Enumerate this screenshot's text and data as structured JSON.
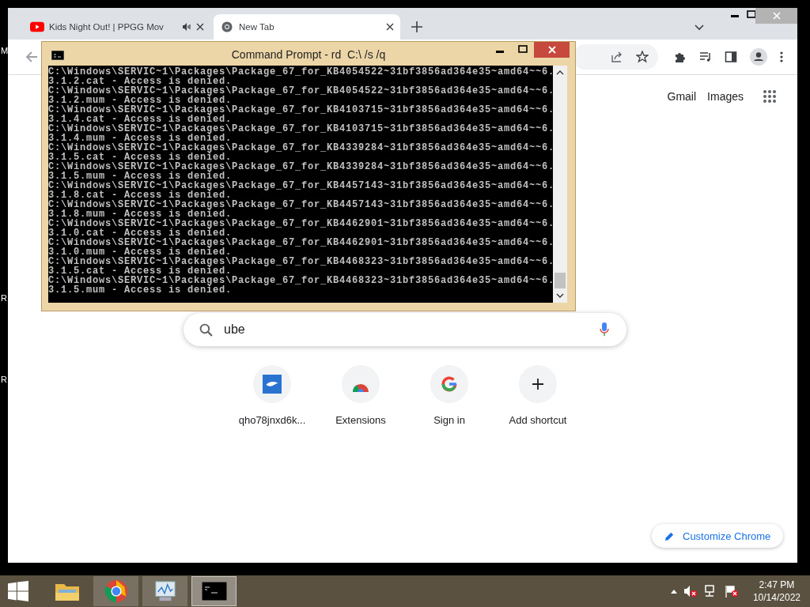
{
  "desktop_labels": [
    "M",
    "R",
    "R"
  ],
  "browser": {
    "tabs": [
      {
        "title": "Kids Night Out! | PPGG Mov",
        "kind": "video",
        "audio": true,
        "selected": false
      },
      {
        "title": "New Tab",
        "kind": "chrome",
        "audio": false,
        "selected": true
      }
    ],
    "top_links": [
      "Gmail",
      "Images"
    ],
    "search": {
      "value": "ube"
    },
    "shortcuts": [
      {
        "label": "qho78jnxd6k...",
        "kind": "site"
      },
      {
        "label": "Extensions",
        "kind": "webstore"
      },
      {
        "label": "Sign in",
        "kind": "google"
      },
      {
        "label": "Add shortcut",
        "kind": "add"
      }
    ],
    "customize_button": "Customize Chrome"
  },
  "cmd": {
    "title": "Command Prompt - rd  C:\\ /s /q",
    "lines": [
      "C:\\Windows\\SERVIC~1\\Packages\\Package_67_for_KB4054522~31bf3856ad364e35~amd64~~6.",
      "3.1.2.cat - Access is denied.",
      "C:\\Windows\\SERVIC~1\\Packages\\Package_67_for_KB4054522~31bf3856ad364e35~amd64~~6.",
      "3.1.2.mum - Access is denied.",
      "C:\\Windows\\SERVIC~1\\Packages\\Package_67_for_KB4103715~31bf3856ad364e35~amd64~~6.",
      "3.1.4.cat - Access is denied.",
      "C:\\Windows\\SERVIC~1\\Packages\\Package_67_for_KB4103715~31bf3856ad364e35~amd64~~6.",
      "3.1.4.mum - Access is denied.",
      "C:\\Windows\\SERVIC~1\\Packages\\Package_67_for_KB4339284~31bf3856ad364e35~amd64~~6.",
      "3.1.5.cat - Access is denied.",
      "C:\\Windows\\SERVIC~1\\Packages\\Package_67_for_KB4339284~31bf3856ad364e35~amd64~~6.",
      "3.1.5.mum - Access is denied.",
      "C:\\Windows\\SERVIC~1\\Packages\\Package_67_for_KB4457143~31bf3856ad364e35~amd64~~6.",
      "3.1.8.cat - Access is denied.",
      "C:\\Windows\\SERVIC~1\\Packages\\Package_67_for_KB4457143~31bf3856ad364e35~amd64~~6.",
      "3.1.8.mum - Access is denied.",
      "C:\\Windows\\SERVIC~1\\Packages\\Package_67_for_KB4462901~31bf3856ad364e35~amd64~~6.",
      "3.1.0.cat - Access is denied.",
      "C:\\Windows\\SERVIC~1\\Packages\\Package_67_for_KB4462901~31bf3856ad364e35~amd64~~6.",
      "3.1.0.mum - Access is denied.",
      "C:\\Windows\\SERVIC~1\\Packages\\Package_67_for_KB4468323~31bf3856ad364e35~amd64~~6.",
      "3.1.5.cat - Access is denied.",
      "C:\\Windows\\SERVIC~1\\Packages\\Package_67_for_KB4468323~31bf3856ad364e35~amd64~~6.",
      "3.1.5.mum - Access is denied."
    ]
  },
  "taskbar": {
    "apps": [
      {
        "kind": "folder",
        "selected": false
      },
      {
        "kind": "chrome",
        "selected": false
      },
      {
        "kind": "monitor",
        "selected": false
      },
      {
        "kind": "cmd",
        "selected": true
      }
    ],
    "time": "2:47 PM",
    "date": "10/14/2022"
  }
}
